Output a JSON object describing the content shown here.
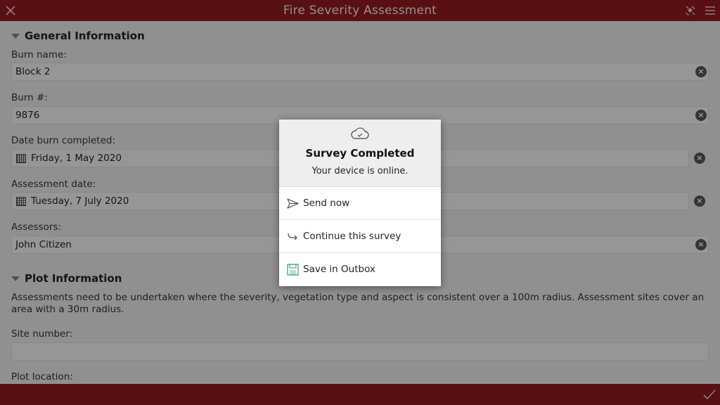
{
  "app": {
    "title": "Fire Severity Assessment"
  },
  "sections": {
    "general": {
      "title": "General Information",
      "fields": [
        {
          "label": "Burn name:",
          "value": "Block 2"
        },
        {
          "label": "Burn #:",
          "value": "9876"
        },
        {
          "label": "Date burn completed:",
          "value": "Friday, 1 May 2020"
        },
        {
          "label": "Assessment date:",
          "value": "Tuesday, 7 July 2020"
        },
        {
          "label": "Assessors:",
          "value": "John Citizen"
        }
      ]
    },
    "plot": {
      "title": "Plot Information",
      "description": "Assessments need to be undertaken where the severity, vegetation type and aspect is consistent over a 100m radius. Assessment sites cover an area with a 30m radius.",
      "site_number_label": "Site number:",
      "site_number_value": "",
      "plot_location_label": "Plot location:"
    }
  },
  "dialog": {
    "title": "Survey Completed",
    "subtitle": "Your device is online.",
    "options": [
      {
        "label": "Send now",
        "icon": "send-icon"
      },
      {
        "label": "Continue this survey",
        "icon": "arrow-icon"
      },
      {
        "label": "Save in Outbox",
        "icon": "save-icon"
      }
    ]
  },
  "colors": {
    "brand": "#8e1a1d",
    "save_icon": "#3aa57a"
  }
}
